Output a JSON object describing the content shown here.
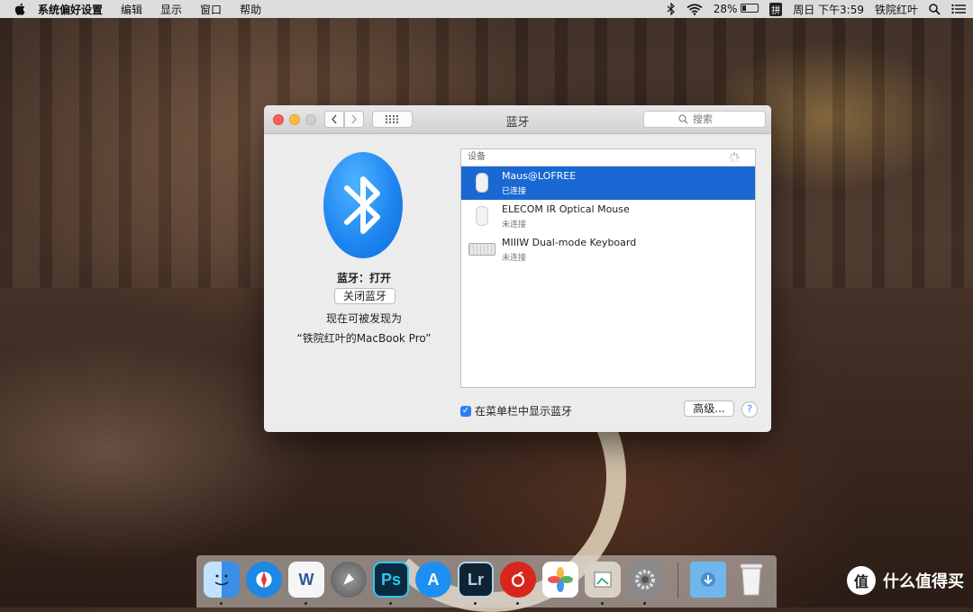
{
  "menubar": {
    "app_name": "系统偏好设置",
    "menus": [
      "编辑",
      "显示",
      "窗口",
      "帮助"
    ],
    "battery_percent": "28%",
    "ime": "拼",
    "clock": "周日 下午3:59",
    "user": "铁院红叶"
  },
  "window": {
    "title": "蓝牙",
    "search_placeholder": "搜索"
  },
  "bluetooth": {
    "status": "蓝牙：打开",
    "toggle_label": "关闭蓝牙",
    "discoverable_line1": "现在可被发现为",
    "discoverable_line2": "“铁院红叶的MacBook Pro”"
  },
  "devices": {
    "header": "设备",
    "items": [
      {
        "name": "Maus@LOFREE",
        "status": "已连接",
        "icon": "mouse-icon",
        "selected": true
      },
      {
        "name": "ELECOM IR Optical Mouse",
        "status": "未连接",
        "icon": "mouse-icon",
        "selected": false
      },
      {
        "name": "MIIIW Dual-mode Keyboard",
        "status": "未连接",
        "icon": "keyboard-icon",
        "selected": false
      }
    ]
  },
  "bottom": {
    "show_in_menubar_label": "在菜单栏中显示蓝牙",
    "show_in_menubar_checked": true,
    "advanced_label": "高级...",
    "help_label": "?"
  },
  "dock": {
    "apps": [
      {
        "name": "finder-icon",
        "label": "",
        "color": "#3a8ee6",
        "running": true
      },
      {
        "name": "safari-icon",
        "label": "",
        "color": "#1e88e5",
        "running": false
      },
      {
        "name": "word-icon",
        "label": "W",
        "color": "#2b5797",
        "running": true
      },
      {
        "name": "launchpad-icon",
        "label": "",
        "color": "#6b6b6b",
        "running": false
      },
      {
        "name": "photoshop-icon",
        "label": "Ps",
        "color": "#0b2a3f",
        "running": true
      },
      {
        "name": "app-store-icon",
        "label": "A",
        "color": "#1d8ff2",
        "running": false
      },
      {
        "name": "lightroom-icon",
        "label": "Lr",
        "color": "#0f2330",
        "running": true
      },
      {
        "name": "netease-music-icon",
        "label": "",
        "color": "#d9261c",
        "running": true
      },
      {
        "name": "photos-icon",
        "label": "",
        "color": "#ffffff",
        "running": false
      },
      {
        "name": "preview-icon",
        "label": "",
        "color": "#d8d2c4",
        "running": true
      },
      {
        "name": "system-preferences-icon",
        "label": "",
        "color": "#7a7a7a",
        "running": true
      },
      {
        "name": "downloads-folder-icon",
        "label": "",
        "color": "#6fb6ec",
        "running": false
      },
      {
        "name": "trash-icon",
        "label": "",
        "color": "#e8e8e8",
        "running": false
      }
    ]
  },
  "watermark": {
    "logo": "值",
    "text": "什么值得买"
  }
}
